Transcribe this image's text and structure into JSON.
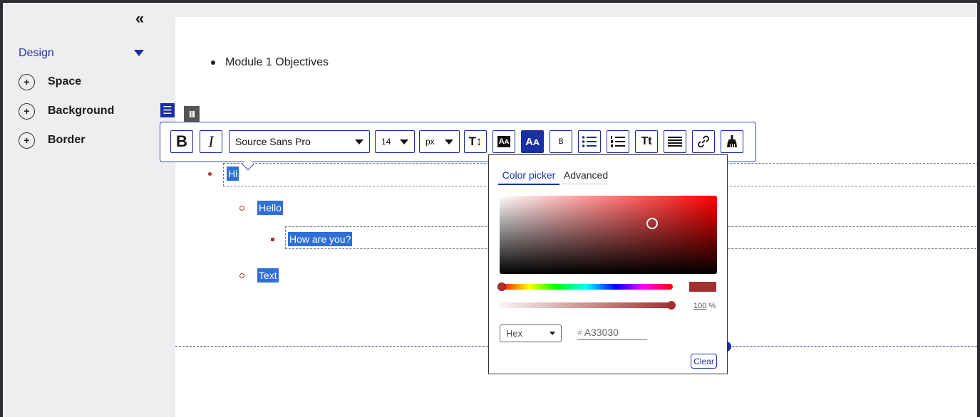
{
  "sidebar": {
    "collapse_glyph": "«",
    "design_label": "Design",
    "items": [
      {
        "label": "Space",
        "icon": "plus-icon"
      },
      {
        "label": "Background",
        "icon": "plus-icon"
      },
      {
        "label": "Border",
        "icon": "plus-icon"
      }
    ]
  },
  "content": {
    "module_item": "Module 1 Objectives",
    "list": [
      {
        "text": "Hi",
        "level": 1
      },
      {
        "text": "Hello",
        "level": 2
      },
      {
        "text": "How are you?",
        "level": 3
      },
      {
        "text": "Text",
        "level": 2
      }
    ]
  },
  "toolbar": {
    "bold": "B",
    "italic": "I",
    "font_family": "Source Sans Pro",
    "font_size": "14",
    "unit": "px",
    "line_height_glyph": "T↕",
    "text_bg_glyph": "Aᴀ",
    "text_color_glyph": "Aᴀ",
    "small_bold": "B",
    "title_case_glyph": "Tt",
    "icons": [
      "bold-icon",
      "italic-icon",
      "line-height-icon",
      "text-background-icon",
      "text-color-icon",
      "bulleted-list-icon",
      "numbered-list-icon",
      "title-case-icon",
      "align-justify-icon",
      "link-icon",
      "clear-format-icon"
    ]
  },
  "color_picker": {
    "tab_picker": "Color picker",
    "tab_advanced": "Advanced",
    "alpha": "100",
    "alpha_unit": "%",
    "format": "Hex",
    "hex_prefix": "#",
    "hex_value": "A33030",
    "clear_label": "Clear",
    "current_color": "#A33030",
    "accent_color": "#1a2fa0"
  }
}
